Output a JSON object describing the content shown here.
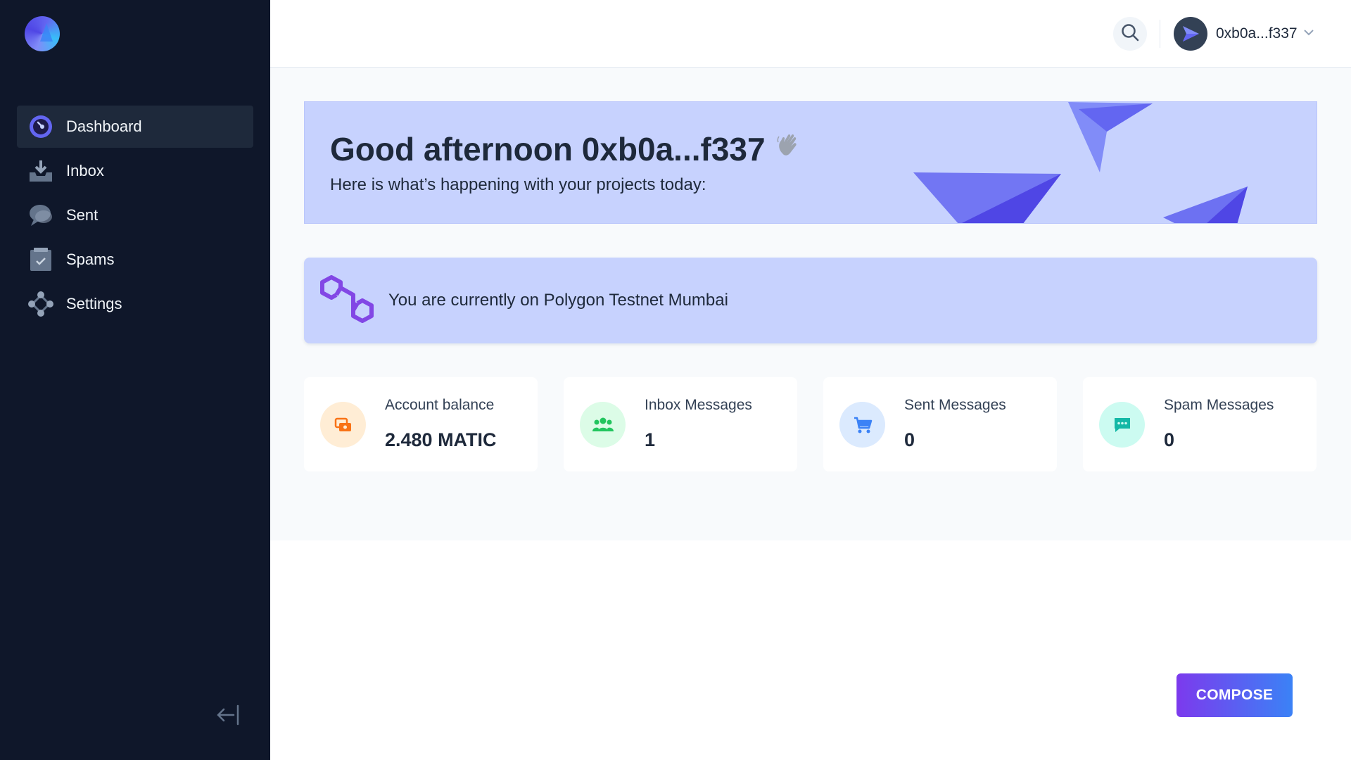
{
  "sidebar": {
    "logo_icon": "app-logo-icon",
    "items": [
      {
        "label": "Dashboard",
        "icon": "dashboard-icon",
        "active": true
      },
      {
        "label": "Inbox",
        "icon": "inbox-icon",
        "active": false
      },
      {
        "label": "Sent",
        "icon": "chat-bubble-icon",
        "active": false
      },
      {
        "label": "Spams",
        "icon": "clipboard-check-icon",
        "active": false
      },
      {
        "label": "Settings",
        "icon": "settings-nodes-icon",
        "active": false
      }
    ],
    "collapse_icon": "arrow-left-bar-icon"
  },
  "header": {
    "search_icon": "search-icon",
    "user_name": "0xb0a...f337",
    "avatar_icon": "paper-plane-icon",
    "menu_icon": "chevron-down-icon"
  },
  "welcome": {
    "title": "Good afternoon 0xb0a...f337",
    "wave_icon": "waving-hand-icon",
    "subtitle": "Here is what’s happening with your projects today:"
  },
  "network": {
    "icon": "polygon-icon",
    "text": "You are currently on Polygon Testnet Mumbai"
  },
  "stats": [
    {
      "label": "Account balance",
      "value": "2.480 MATIC",
      "icon": "wallet-icon",
      "bg": "#ffedd5",
      "fg": "#f97316"
    },
    {
      "label": "Inbox Messages",
      "value": "1",
      "icon": "users-icon",
      "bg": "#dcfce7",
      "fg": "#22c55e"
    },
    {
      "label": "Sent Messages",
      "value": "0",
      "icon": "cart-icon",
      "bg": "#dbeafe",
      "fg": "#3b82f6"
    },
    {
      "label": "Spam Messages",
      "value": "0",
      "icon": "message-icon",
      "bg": "#ccfbf1",
      "fg": "#14b8a6"
    }
  ],
  "compose_label": "COMPOSE",
  "colors": {
    "sidebar_bg": "#0f172a",
    "active_item_bg": "#1e293b",
    "banner_bg": "#c7d2fe",
    "accent_start": "#7c3aed",
    "accent_end": "#3b82f6",
    "polygon_purple": "#8247e5"
  }
}
